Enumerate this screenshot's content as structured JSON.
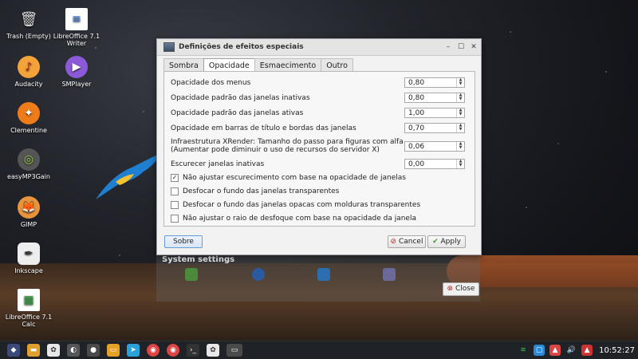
{
  "desktop": {
    "icons": [
      {
        "label": "Trash (Empty)",
        "icon": "trash-icon"
      },
      {
        "label": "LibreOffice 7.1 Writer",
        "icon": "writer-icon"
      },
      {
        "label": "Audacity",
        "icon": "audacity-icon"
      },
      {
        "label": "SMPlayer",
        "icon": "smplayer-icon"
      },
      {
        "label": "Clementine",
        "icon": "clementine-icon"
      },
      {
        "label": "easyMP3Gain",
        "icon": "easymp3gain-icon"
      },
      {
        "label": "GIMP",
        "icon": "gimp-icon"
      },
      {
        "label": "Inkscape",
        "icon": "inkscape-icon"
      },
      {
        "label": "LibreOffice 7.1 Calc",
        "icon": "calc-icon"
      }
    ]
  },
  "dialog": {
    "title": "Definições de efeitos especiais",
    "tabs": [
      {
        "label": "Sombra",
        "active": false
      },
      {
        "label": "Opacidade",
        "active": true
      },
      {
        "label": "Esmaecimento",
        "active": false
      },
      {
        "label": "Outro",
        "active": false
      }
    ],
    "settings": [
      {
        "label": "Opacidade dos menus",
        "value": "0,80"
      },
      {
        "label": "Opacidade padrão das janelas inativas",
        "value": "0,80"
      },
      {
        "label": "Opacidade padrão das janelas ativas",
        "value": "1,00"
      },
      {
        "label": "Opacidade em barras de título e bordas das janelas",
        "value": "0,70"
      },
      {
        "label": "Infraestrutura XRender: Tamanho do passo para figuras com alfa",
        "label2": "(Aumentar pode diminuir o uso de recursos do servidor X)",
        "value": "0,06"
      },
      {
        "label": "Escurecer janelas inativas",
        "value": "0,00"
      }
    ],
    "checkboxes": [
      {
        "label": "Não ajustar escurecimento com base na opacidade de janelas",
        "checked": true
      },
      {
        "label": "Desfocar o fundo das janelas transparentes",
        "checked": false
      },
      {
        "label": "Desfocar o fundo das janelas opacas com molduras transparentes",
        "checked": false
      },
      {
        "label": "Não ajustar o raio de desfoque com base na opacidade da janela",
        "checked": false
      }
    ],
    "about_label": "Sobre",
    "cancel_label": "Cancel",
    "apply_label": "Apply"
  },
  "system_settings": {
    "heading": "System settings",
    "close_label": "Close"
  },
  "taskbar": {
    "clock": "10:52:27"
  }
}
